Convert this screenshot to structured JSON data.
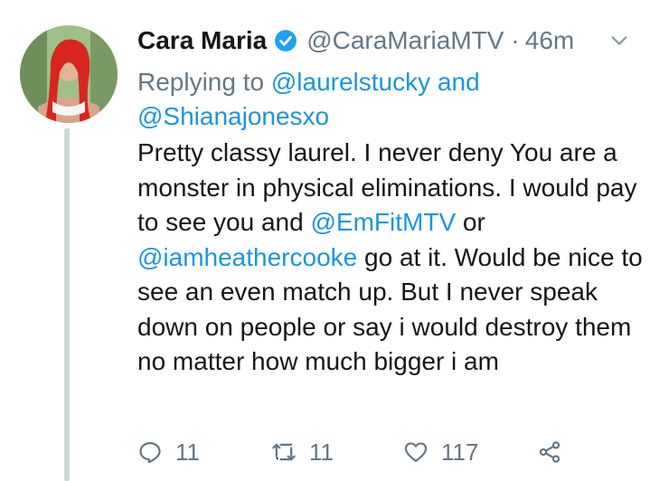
{
  "tweet": {
    "author_name": "Cara Maria",
    "handle": "@CaraMariaMTV",
    "separator": "·",
    "time": "46m",
    "replying_prefix": "Replying to",
    "reply_user_1": "@laurelstucky",
    "reply_conj": "and",
    "reply_user_2": "@Shianajonesxo",
    "text": {
      "p1": "Pretty classy laurel. I never deny You are a monster in physical eliminations. I would pay to see you and ",
      "mention_1": "@EmFitMTV",
      "p2": " or ",
      "mention_2": "@iamheathercooke",
      "p3": " go at it. Would be nice to see an even match up. But I never speak down on people or say i would destroy them no matter how much bigger i am"
    }
  },
  "actions": {
    "reply_count": "11",
    "retweet_count": "11",
    "like_count": "117"
  },
  "icons": {
    "verified": "verified-badge-icon",
    "menu": "chevron-down-icon",
    "reply": "reply-icon",
    "retweet": "retweet-icon",
    "like": "heart-icon",
    "share": "share-icon"
  },
  "colors": {
    "link": "#1b95e0",
    "secondary_text": "#657786",
    "thread_line": "#cfd9de"
  }
}
